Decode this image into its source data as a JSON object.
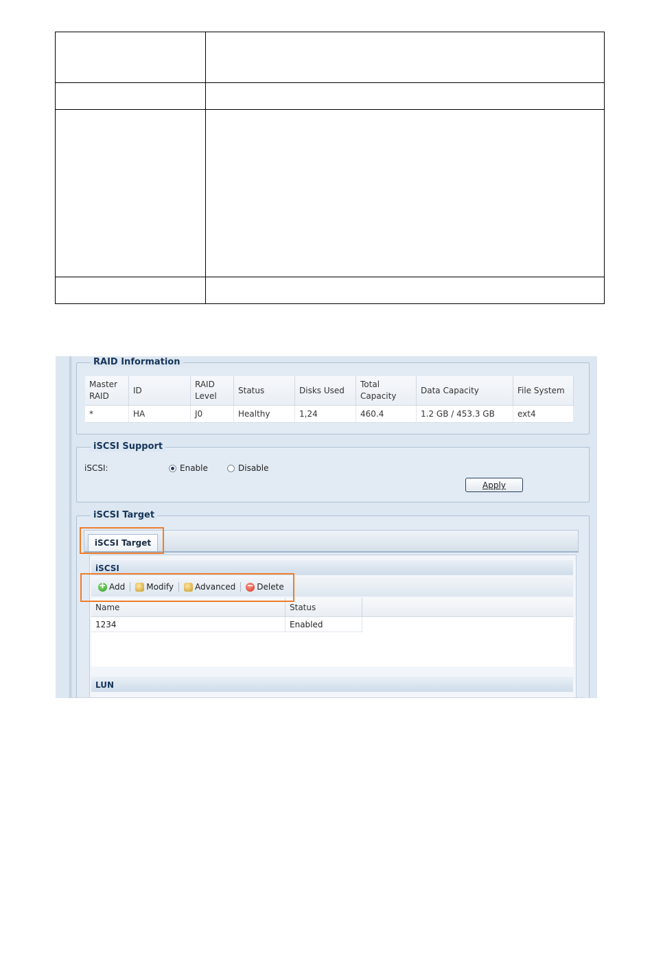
{
  "raid_information": {
    "legend": "RAID Information",
    "headers": [
      "Master RAID",
      "ID",
      "RAID Level",
      "Status",
      "Disks Used",
      "Total Capacity",
      "Data Capacity",
      "File System"
    ],
    "row": [
      "*",
      "HA",
      "J0",
      "Healthy",
      "1,24",
      "460.4",
      "1.2 GB / 453.3 GB",
      "ext4"
    ]
  },
  "iscsi_support": {
    "legend": "iSCSI Support",
    "label": "iSCSI:",
    "options": [
      "Enable",
      "Disable"
    ],
    "selected": "Enable",
    "apply_label": "Apply"
  },
  "iscsi_target": {
    "legend": "iSCSI Target",
    "tab_label": "iSCSI Target",
    "panel_title": "iSCSI",
    "toolbar": {
      "add": "Add",
      "modify": "Modify",
      "advanced": "Advanced",
      "delete": "Delete"
    },
    "grid_headers": [
      "Name",
      "Status"
    ],
    "grid_rows": [
      [
        "1234",
        "Enabled"
      ]
    ],
    "lun_title": "LUN"
  },
  "colors": {
    "highlight": "#ee7d2b",
    "panel_bg": "#dde7f1",
    "heading": "#15355a"
  }
}
